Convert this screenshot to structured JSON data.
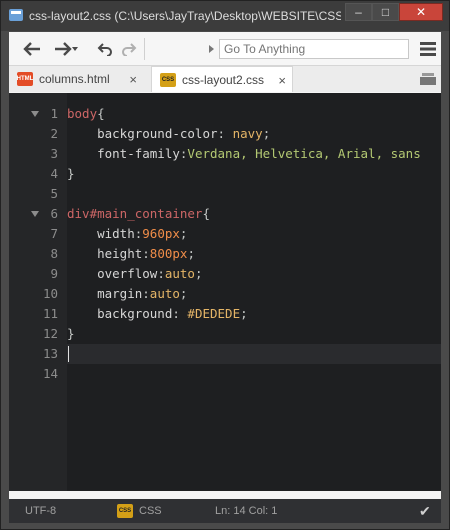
{
  "window": {
    "title": "css-layout2.css (C:\\Users\\JayTray\\Desktop\\WEBSITE\\CSS...",
    "minimize": "–",
    "maximize": "□",
    "close": "✕"
  },
  "toolbar": {
    "search_placeholder": "Go To Anything"
  },
  "tabs": [
    {
      "label": "columns.html",
      "badge": "HTML",
      "badge_color": "#e34c26",
      "active": false,
      "close": "×"
    },
    {
      "label": "css-layout2.css",
      "badge": "CSS",
      "badge_color": "#d4a017",
      "active": true,
      "close": "×"
    }
  ],
  "editor": {
    "line_numbers": [
      "1",
      "2",
      "3",
      "4",
      "5",
      "6",
      "7",
      "8",
      "9",
      "10",
      "11",
      "12",
      "13",
      "14"
    ],
    "lines": [
      [
        {
          "t": "body",
          "c": "k-sel"
        },
        {
          "t": "{",
          "c": "k-punct"
        }
      ],
      [
        {
          "t": "    background-color",
          "c": "k-prop"
        },
        {
          "t": ": ",
          "c": "k-punct"
        },
        {
          "t": "navy",
          "c": "k-val"
        },
        {
          "t": ";",
          "c": "k-punct"
        }
      ],
      [
        {
          "t": "    font-family",
          "c": "k-prop"
        },
        {
          "t": ":",
          "c": "k-punct"
        },
        {
          "t": "Verdana, Helvetica, Arial, sans",
          "c": "k-str"
        }
      ],
      [
        {
          "t": "}",
          "c": "k-punct"
        }
      ],
      [],
      [
        {
          "t": "div",
          "c": "k-sel"
        },
        {
          "t": "#main_container",
          "c": "k-hash"
        },
        {
          "t": "{",
          "c": "k-punct"
        }
      ],
      [
        {
          "t": "    width",
          "c": "k-prop"
        },
        {
          "t": ":",
          "c": "k-punct"
        },
        {
          "t": "960px",
          "c": "k-num"
        },
        {
          "t": ";",
          "c": "k-punct"
        }
      ],
      [
        {
          "t": "    height",
          "c": "k-prop"
        },
        {
          "t": ":",
          "c": "k-punct"
        },
        {
          "t": "800px",
          "c": "k-num"
        },
        {
          "t": ";",
          "c": "k-punct"
        }
      ],
      [
        {
          "t": "    overflow",
          "c": "k-prop"
        },
        {
          "t": ":",
          "c": "k-punct"
        },
        {
          "t": "auto",
          "c": "k-val"
        },
        {
          "t": ";",
          "c": "k-punct"
        }
      ],
      [
        {
          "t": "    margin",
          "c": "k-prop"
        },
        {
          "t": ":",
          "c": "k-punct"
        },
        {
          "t": "auto",
          "c": "k-val"
        },
        {
          "t": ";",
          "c": "k-punct"
        }
      ],
      [
        {
          "t": "    background",
          "c": "k-prop"
        },
        {
          "t": ": ",
          "c": "k-punct"
        },
        {
          "t": "#DEDEDE",
          "c": "k-val"
        },
        {
          "t": ";",
          "c": "k-punct"
        }
      ],
      [
        {
          "t": "}",
          "c": "k-punct"
        }
      ],
      [],
      []
    ],
    "fold_lines": [
      "1",
      "6"
    ]
  },
  "status": {
    "encoding": "UTF-8",
    "lang_badge": "CSS",
    "language": "CSS",
    "position": "Ln: 14 Col: 1",
    "check": "✔"
  }
}
